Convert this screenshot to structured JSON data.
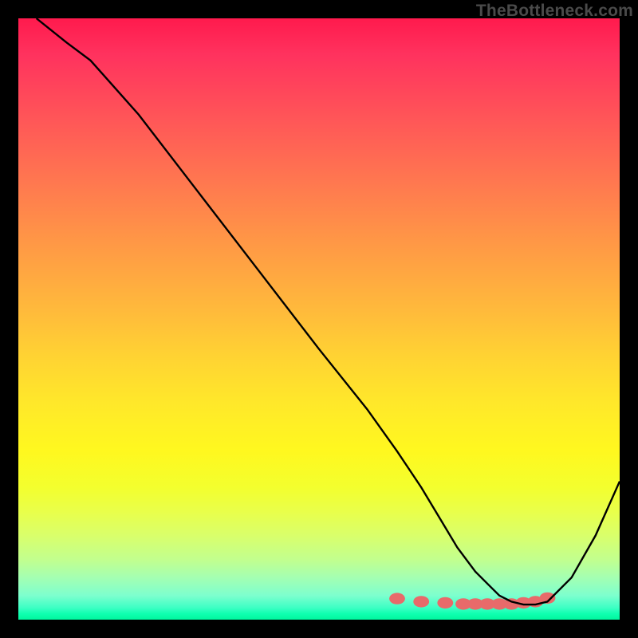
{
  "watermark": "TheBottleneck.com",
  "chart_data": {
    "type": "line",
    "title": "",
    "xlabel": "",
    "ylabel": "",
    "xlim": [
      0,
      100
    ],
    "ylim": [
      0,
      100
    ],
    "series": [
      {
        "name": "curve",
        "x": [
          3,
          8,
          12,
          20,
          30,
          40,
          50,
          58,
          63,
          67,
          70,
          73,
          76,
          78,
          80,
          82,
          84,
          86,
          88,
          92,
          96,
          100
        ],
        "y": [
          100,
          96,
          93,
          84,
          71,
          58,
          45,
          35,
          28,
          22,
          17,
          12,
          8,
          6,
          4,
          3,
          2.5,
          2.5,
          3,
          7,
          14,
          23
        ],
        "color": "#000000",
        "width": 2.4
      },
      {
        "name": "markers",
        "x": [
          63,
          67,
          71,
          74,
          76,
          78,
          80,
          82,
          84,
          86,
          88
        ],
        "y": [
          3.5,
          3,
          2.8,
          2.6,
          2.6,
          2.6,
          2.6,
          2.6,
          2.8,
          3,
          3.6
        ],
        "color": "#e86a6a",
        "size": 11
      }
    ],
    "background_gradient": {
      "top": "#ff1a4d",
      "bottom": "#00f79e"
    }
  }
}
